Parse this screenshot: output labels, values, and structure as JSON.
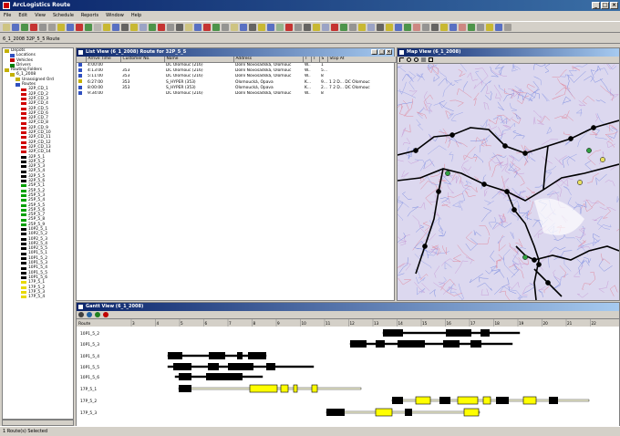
{
  "app": {
    "title": "ArcLogistics Route",
    "window_buttons": [
      "_",
      "□",
      "×"
    ]
  },
  "menu": [
    "File",
    "Edit",
    "View",
    "Schedule",
    "Reports",
    "Window",
    "Help"
  ],
  "breadcrumb": "6_1_2008 32P_5_5 Route",
  "status": "1 Route(s) Selected",
  "tree": {
    "top_items": [
      {
        "label": "Depots",
        "icon": "folder-icon",
        "color": "#c4b000"
      },
      {
        "label": "Locations",
        "icon": "location-icon",
        "color": "#3050c0"
      },
      {
        "label": "Vehicles",
        "icon": "truck-icon",
        "color": "#c00000"
      },
      {
        "label": "Drivers",
        "icon": "driver-icon",
        "color": "#008000"
      },
      {
        "label": "Routing Folders",
        "icon": "folder-icon",
        "color": "#c4b000"
      },
      {
        "label": "6_1_2008",
        "icon": "folder-icon",
        "color": "#c4b000"
      },
      {
        "label": "Unassigned Ord",
        "icon": "unassigned-icon",
        "color": "#c4b000"
      },
      {
        "label": "Routes",
        "icon": "routes-icon",
        "color": "#3050c0"
      }
    ],
    "routes": [
      {
        "label": "32P_CD_1",
        "color": "#d00000"
      },
      {
        "label": "32P_CD_2",
        "color": "#d00000"
      },
      {
        "label": "32P_CD_3",
        "color": "#d00000"
      },
      {
        "label": "32P_CD_4",
        "color": "#d00000"
      },
      {
        "label": "32P_CD_5",
        "color": "#d00000"
      },
      {
        "label": "32P_CD_6",
        "color": "#d00000"
      },
      {
        "label": "32P_CD_7",
        "color": "#d00000"
      },
      {
        "label": "32P_CD_8",
        "color": "#d00000"
      },
      {
        "label": "32P_CD_9",
        "color": "#d00000"
      },
      {
        "label": "32P_CD_10",
        "color": "#d00000"
      },
      {
        "label": "32P_CD_11",
        "color": "#d00000"
      },
      {
        "label": "32P_CD_12",
        "color": "#d00000"
      },
      {
        "label": "32P_CD_13",
        "color": "#d00000"
      },
      {
        "label": "32P_CD_14",
        "color": "#d00000"
      },
      {
        "label": "32P_5_1",
        "color": "#000000"
      },
      {
        "label": "32P_5_2",
        "color": "#000000"
      },
      {
        "label": "32P_5_3",
        "color": "#000000"
      },
      {
        "label": "32P_5_4",
        "color": "#000000"
      },
      {
        "label": "32P_5_5",
        "color": "#000000"
      },
      {
        "label": "32P_5_6",
        "color": "#000000"
      },
      {
        "label": "25P_5_1",
        "color": "#00a000"
      },
      {
        "label": "25P_5_2",
        "color": "#00a000"
      },
      {
        "label": "25P_5_3",
        "color": "#00a000"
      },
      {
        "label": "25P_5_4",
        "color": "#00a000"
      },
      {
        "label": "25P_5_5",
        "color": "#00a000"
      },
      {
        "label": "25P_5_6",
        "color": "#00a000"
      },
      {
        "label": "25P_5_7",
        "color": "#00a000"
      },
      {
        "label": "25P_5_8",
        "color": "#00a000"
      },
      {
        "label": "25P_5_9",
        "color": "#00a000"
      },
      {
        "label": "10P2_5_1",
        "color": "#000000"
      },
      {
        "label": "10P2_5_2",
        "color": "#000000"
      },
      {
        "label": "10P2_5_3",
        "color": "#000000"
      },
      {
        "label": "10P2_5_4",
        "color": "#000000"
      },
      {
        "label": "10P2_5_5",
        "color": "#000000"
      },
      {
        "label": "10P1_5_1",
        "color": "#000000"
      },
      {
        "label": "10P1_5_2",
        "color": "#000000"
      },
      {
        "label": "10P1_5_3",
        "color": "#000000"
      },
      {
        "label": "10P1_5_4",
        "color": "#000000"
      },
      {
        "label": "10P1_5_5",
        "color": "#000000"
      },
      {
        "label": "10P1_5_6",
        "color": "#000000"
      },
      {
        "label": "17P_5_1",
        "color": "#e8d800"
      },
      {
        "label": "17P_5_2",
        "color": "#e8d800"
      },
      {
        "label": "17P_5_3",
        "color": "#e8d800"
      },
      {
        "label": "17P_5_4",
        "color": "#e8d800"
      }
    ]
  },
  "list_view": {
    "title": "List View (6_1_2008) Route for 32P_5_5",
    "columns": [
      "",
      "Arrive Time",
      "Customer No.",
      "Name",
      "Address",
      "T",
      "T",
      "S",
      "Stop At"
    ],
    "rows": [
      [
        "",
        "4:00:00",
        "",
        "DC Olomouc (216)",
        "Dolní Novosadská, Olomouc",
        "W...",
        "",
        "1",
        ""
      ],
      [
        "",
        "4:13:00",
        "353",
        "DC Olomouc (216)",
        "Dolní Novosadská, Olomouc",
        "W...",
        "",
        "5...",
        ""
      ],
      [
        "",
        "5:11:00",
        "353",
        "DC Olomouc (216)",
        "Dolní Novosadská, Olomouc",
        "W...",
        "",
        "8",
        ""
      ],
      [
        "",
        "6:27:00",
        "353",
        "S_HYPER (353)",
        "Olomoucká, Opava",
        "K...",
        "",
        "9...",
        "1 2 D... DC Olomouc"
      ],
      [
        "",
        "8:00:00",
        "353",
        "S_HYPER (353)",
        "Olomoucká, Opava",
        "K...",
        "",
        "2...",
        "7 2 D... DC Olomouc"
      ],
      [
        "",
        "9:34:00",
        "",
        "DC Olomouc (216)",
        "Dolní Novosadská, Olomouc",
        "W...",
        "",
        "8",
        ""
      ]
    ]
  },
  "map_view": {
    "title": "Map View (6_1_2008)"
  },
  "gantt": {
    "title": "Gantt View (6_1_2008)",
    "header": "Route",
    "hours": [
      "3",
      "4",
      "5",
      "6",
      "7",
      "8",
      "9",
      "10",
      "11",
      "12",
      "13",
      "14",
      "15",
      "16",
      "17",
      "18",
      "19",
      "20",
      "21",
      "22"
    ],
    "rows": [
      {
        "label": "10P1_5_2",
        "color": "#000000"
      },
      {
        "label": "10P1_5_3",
        "color": "#000000"
      },
      {
        "label": "10P1_5_4",
        "color": "#000000"
      },
      {
        "label": "10P1_5_5",
        "color": "#000000"
      },
      {
        "label": "10P1_5_6",
        "color": "#000000"
      },
      {
        "label": "17P_5_1",
        "color": "#e8d800"
      },
      {
        "label": "17P_5_2",
        "color": "#e8d800"
      },
      {
        "label": "17P_5_3",
        "color": "#e8d800"
      }
    ]
  }
}
